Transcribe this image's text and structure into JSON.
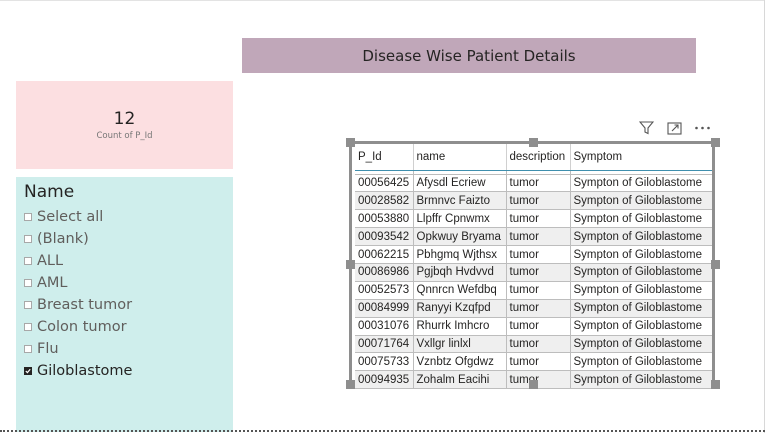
{
  "report": {
    "title": "Disease Wise Patient Details"
  },
  "card": {
    "value": "12",
    "label": "Count of P_Id"
  },
  "slicer": {
    "title": "Name",
    "items": [
      {
        "label": "Select all",
        "checked": false
      },
      {
        "label": "(Blank)",
        "checked": false
      },
      {
        "label": "ALL",
        "checked": false
      },
      {
        "label": "AML",
        "checked": false
      },
      {
        "label": "Breast tumor",
        "checked": false
      },
      {
        "label": "Colon tumor",
        "checked": false
      },
      {
        "label": "Flu",
        "checked": false
      },
      {
        "label": "Giloblastome",
        "checked": true
      }
    ]
  },
  "visual_header": {
    "icons": [
      "filter-icon",
      "focus-mode-icon",
      "more-options-icon"
    ]
  },
  "table": {
    "columns": [
      "P_Id",
      "name",
      "description",
      "Symptom"
    ],
    "rows": [
      [
        "00056425",
        "Afysdl Ecriew",
        "tumor",
        "Sympton of Giloblastome"
      ],
      [
        "00028582",
        "Brmnvc Faizto",
        "tumor",
        "Sympton of Giloblastome"
      ],
      [
        "00053880",
        "Llpffr Cpnwmx",
        "tumor",
        "Sympton of Giloblastome"
      ],
      [
        "00093542",
        "Opkwuy Bryama",
        "tumor",
        "Sympton of Giloblastome"
      ],
      [
        "00062215",
        "Pbhgmq Wjthsx",
        "tumor",
        "Sympton of Giloblastome"
      ],
      [
        "00086986",
        "Pgjbqh Hvdvvd",
        "tumor",
        "Sympton of Giloblastome"
      ],
      [
        "00052573",
        "Qnnrcn Wefdbq",
        "tumor",
        "Sympton of Giloblastome"
      ],
      [
        "00084999",
        "Ranyyi Kzqfpd",
        "tumor",
        "Sympton of Giloblastome"
      ],
      [
        "00031076",
        "Rhurrk Imhcro",
        "tumor",
        "Sympton of Giloblastome"
      ],
      [
        "00071764",
        "Vxllgr linlxl",
        "tumor",
        "Sympton of Giloblastome"
      ],
      [
        "00075733",
        "Vznbtz Ofgdwz",
        "tumor",
        "Sympton of Giloblastome"
      ],
      [
        "00094935",
        "Zohalm Eacihi",
        "tumor",
        "Sympton of Giloblastome"
      ]
    ]
  },
  "colors": {
    "title_band": "#c0a7b9",
    "card_bg": "#fcdfe1",
    "slicer_bg": "#cfeeec",
    "header_underline": "#3f8fae"
  }
}
